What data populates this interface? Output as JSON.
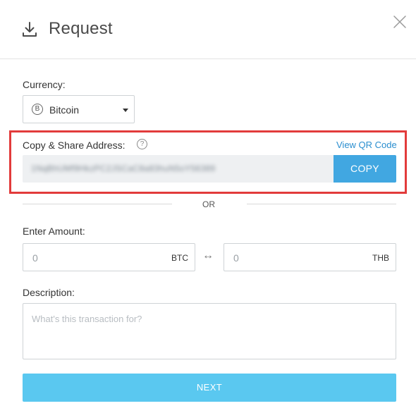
{
  "header": {
    "title": "Request",
    "icon": "download-icon",
    "close_icon": "close-icon"
  },
  "currency": {
    "label": "Currency:",
    "selected": "Bitcoin",
    "coin_symbol": "B",
    "coin_icon": "bitcoin-icon"
  },
  "address": {
    "label": "Copy & Share Address:",
    "help_symbol": "?",
    "view_qr_label": "View QR Code",
    "value": "1NqBhUMf9HkzPC2JSCaC8a83huN5oY56389",
    "copy_label": "COPY"
  },
  "divider": {
    "text": "OR"
  },
  "amount": {
    "label": "Enter Amount:",
    "btc_value": "0",
    "btc_unit": "BTC",
    "swap_symbol": "↔",
    "fiat_value": "0",
    "fiat_unit": "THB"
  },
  "description": {
    "label": "Description:",
    "placeholder": "What's this transaction for?"
  },
  "footer": {
    "next_label": "NEXT"
  },
  "colors": {
    "accent": "#41a7e1",
    "next_button": "#5ac8f0",
    "highlight": "#e23b3b",
    "link": "#2a8ecf"
  }
}
